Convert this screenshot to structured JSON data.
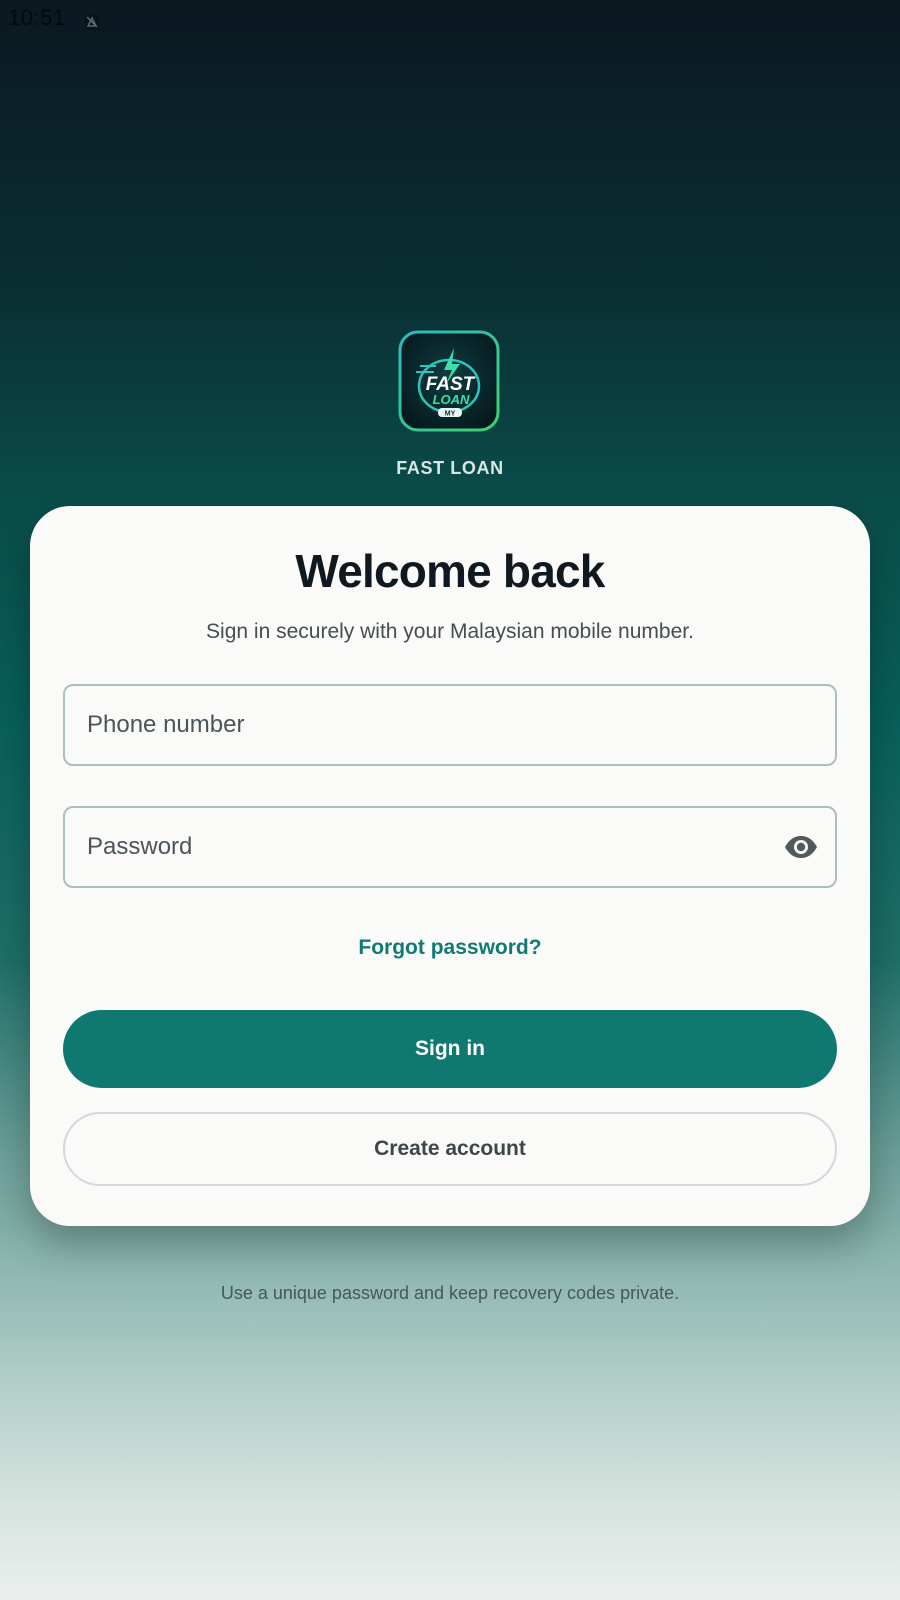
{
  "status_bar": {
    "time": "10:51",
    "notification_icon": "silent-mode-icon"
  },
  "app": {
    "logo_icon": "fast-loan-logo",
    "logo_text_lines": [
      "FAST",
      "LOAN",
      "MY"
    ],
    "name": "FAST LOAN"
  },
  "login_card": {
    "title": "Welcome back",
    "subtitle": "Sign in securely with your Malaysian mobile number.",
    "phone_field": {
      "placeholder": "Phone number",
      "value": ""
    },
    "password_field": {
      "placeholder": "Password",
      "value": "",
      "toggle_icon": "eye-icon"
    },
    "forgot_password_label": "Forgot password?",
    "sign_in_label": "Sign in",
    "create_account_label": "Create account"
  },
  "footer_note": "Use a unique password and keep recovery codes private.",
  "colors": {
    "accent": "#0f7870",
    "link": "#107b72",
    "title": "#101820",
    "card_background": "#fafaf8",
    "field_border": "#aebebb"
  }
}
